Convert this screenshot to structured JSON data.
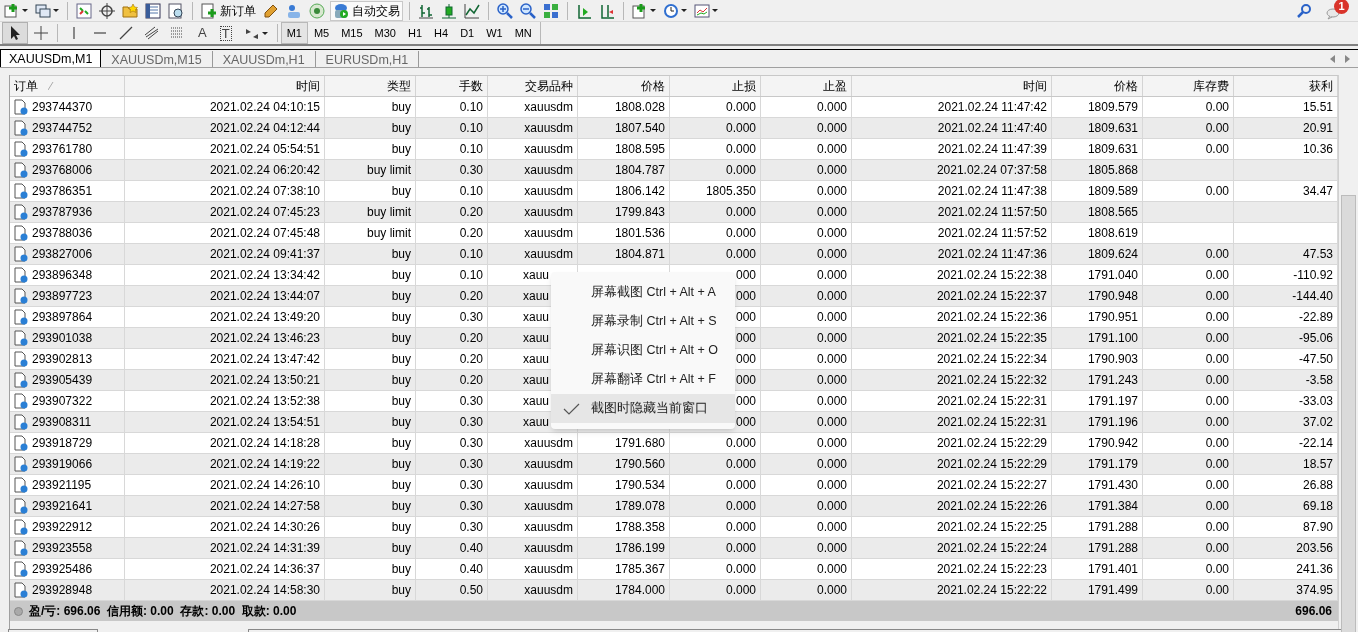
{
  "toolbar": {
    "buttons": [
      {
        "label": "新订单"
      },
      {
        "label": "自动交易"
      }
    ]
  },
  "notification": {
    "badge": "1"
  },
  "drawing_tools": [
    {
      "kind": "icon"
    },
    {
      "kind": "icon"
    },
    {
      "kind": "icon"
    },
    {
      "kind": "icon"
    },
    {
      "kind": "icon"
    },
    {
      "kind": "icon"
    },
    {
      "kind": "icon"
    },
    {
      "kind": "glyph",
      "text": "A"
    },
    {
      "kind": "glyph",
      "text": "T"
    },
    {
      "kind": "icon"
    }
  ],
  "timeframes": [
    {
      "label": "M1",
      "selected": true
    },
    {
      "label": "M5",
      "selected": false
    },
    {
      "label": "M15",
      "selected": false
    },
    {
      "label": "M30",
      "selected": false
    },
    {
      "label": "H1",
      "selected": false
    },
    {
      "label": "H4",
      "selected": false
    },
    {
      "label": "D1",
      "selected": false
    },
    {
      "label": "W1",
      "selected": false
    },
    {
      "label": "MN",
      "selected": false
    }
  ],
  "chart_tabs": [
    {
      "label": "XAUUSDm,M1",
      "selected": true
    },
    {
      "label": "XAUUSDm,M15",
      "selected": false
    },
    {
      "label": "XAUUSDm,H1",
      "selected": false
    },
    {
      "label": "EURUSDm,H1",
      "selected": false
    }
  ],
  "table": {
    "columns": [
      "订单",
      "时间",
      "类型",
      "手数",
      "交易品种",
      "价格",
      "止损",
      "止盈",
      "时间",
      "价格",
      "库存费",
      "获利"
    ],
    "rows": [
      {
        "order": "293744370",
        "open_time": "2021.02.24 04:10:15",
        "type": "buy",
        "lots": "0.10",
        "symbol": "xauusdm",
        "price": "1808.028",
        "sl": "0.000",
        "tp": "0.000",
        "close_time": "2021.02.24 11:47:42",
        "close_price": "1809.579",
        "swap": "0.00",
        "profit": "15.51"
      },
      {
        "order": "293744752",
        "open_time": "2021.02.24 04:12:44",
        "type": "buy",
        "lots": "0.10",
        "symbol": "xauusdm",
        "price": "1807.540",
        "sl": "0.000",
        "tp": "0.000",
        "close_time": "2021.02.24 11:47:40",
        "close_price": "1809.631",
        "swap": "0.00",
        "profit": "20.91"
      },
      {
        "order": "293761780",
        "open_time": "2021.02.24 05:54:51",
        "type": "buy",
        "lots": "0.10",
        "symbol": "xauusdm",
        "price": "1808.595",
        "sl": "0.000",
        "tp": "0.000",
        "close_time": "2021.02.24 11:47:39",
        "close_price": "1809.631",
        "swap": "0.00",
        "profit": "10.36"
      },
      {
        "order": "293768006",
        "open_time": "2021.02.24 06:20:42",
        "type": "buy limit",
        "lots": "0.30",
        "symbol": "xauusdm",
        "price": "1804.787",
        "sl": "0.000",
        "tp": "0.000",
        "close_time": "2021.02.24 07:37:58",
        "close_price": "1805.868"
      },
      {
        "order": "293786351",
        "open_time": "2021.02.24 07:38:10",
        "type": "buy",
        "lots": "0.10",
        "symbol": "xauusdm",
        "price": "1806.142",
        "sl": "1805.350",
        "tp": "0.000",
        "close_time": "2021.02.24 11:47:38",
        "close_price": "1809.589",
        "swap": "0.00",
        "profit": "34.47"
      },
      {
        "order": "293787936",
        "open_time": "2021.02.24 07:45:23",
        "type": "buy limit",
        "lots": "0.20",
        "symbol": "xauusdm",
        "price": "1799.843",
        "sl": "0.000",
        "tp": "0.000",
        "close_time": "2021.02.24 11:57:50",
        "close_price": "1808.565"
      },
      {
        "order": "293788036",
        "open_time": "2021.02.24 07:45:48",
        "type": "buy limit",
        "lots": "0.20",
        "symbol": "xauusdm",
        "price": "1801.536",
        "sl": "0.000",
        "tp": "0.000",
        "close_time": "2021.02.24 11:57:52",
        "close_price": "1808.619"
      },
      {
        "order": "293827006",
        "open_time": "2021.02.24 09:41:37",
        "type": "buy",
        "lots": "0.10",
        "symbol": "xauusdm",
        "price": "1804.871",
        "sl": "0.000",
        "tp": "0.000",
        "close_time": "2021.02.24 11:47:36",
        "close_price": "1809.624",
        "swap": "0.00",
        "profit": "47.53"
      },
      {
        "order": "293896348",
        "open_time": "2021.02.24 13:34:42",
        "type": "buy",
        "lots": "0.10",
        "symbol": "xauu",
        "sl": "000",
        "tp": "0.000",
        "close_time": "2021.02.24 15:22:38",
        "close_price": "1791.040",
        "swap": "0.00",
        "profit": "-110.92"
      },
      {
        "order": "293897723",
        "open_time": "2021.02.24 13:44:07",
        "type": "buy",
        "lots": "0.20",
        "symbol": "xauu",
        "sl": "000",
        "tp": "0.000",
        "close_time": "2021.02.24 15:22:37",
        "close_price": "1790.948",
        "swap": "0.00",
        "profit": "-144.40"
      },
      {
        "order": "293897864",
        "open_time": "2021.02.24 13:49:20",
        "type": "buy",
        "lots": "0.30",
        "symbol": "xauu",
        "sl": "000",
        "tp": "0.000",
        "close_time": "2021.02.24 15:22:36",
        "close_price": "1790.951",
        "swap": "0.00",
        "profit": "-22.89"
      },
      {
        "order": "293901038",
        "open_time": "2021.02.24 13:46:23",
        "type": "buy",
        "lots": "0.20",
        "symbol": "xauu",
        "sl": "000",
        "tp": "0.000",
        "close_time": "2021.02.24 15:22:35",
        "close_price": "1791.100",
        "swap": "0.00",
        "profit": "-95.06"
      },
      {
        "order": "293902813",
        "open_time": "2021.02.24 13:47:42",
        "type": "buy",
        "lots": "0.20",
        "symbol": "xauu",
        "sl": "000",
        "tp": "0.000",
        "close_time": "2021.02.24 15:22:34",
        "close_price": "1790.903",
        "swap": "0.00",
        "profit": "-47.50"
      },
      {
        "order": "293905439",
        "open_time": "2021.02.24 13:50:21",
        "type": "buy",
        "lots": "0.20",
        "symbol": "xauu",
        "sl": "000",
        "tp": "0.000",
        "close_time": "2021.02.24 15:22:32",
        "close_price": "1791.243",
        "swap": "0.00",
        "profit": "-3.58"
      },
      {
        "order": "293907322",
        "open_time": "2021.02.24 13:52:38",
        "type": "buy",
        "lots": "0.30",
        "symbol": "xauu",
        "sl": "000",
        "tp": "0.000",
        "close_time": "2021.02.24 15:22:31",
        "close_price": "1791.197",
        "swap": "0.00",
        "profit": "-33.03"
      },
      {
        "order": "293908311",
        "open_time": "2021.02.24 13:54:51",
        "type": "buy",
        "lots": "0.30",
        "symbol": "xauu",
        "sl": "000",
        "tp": "0.000",
        "close_time": "2021.02.24 15:22:31",
        "close_price": "1791.196",
        "swap": "0.00",
        "profit": "37.02"
      },
      {
        "order": "293918729",
        "open_time": "2021.02.24 14:18:28",
        "type": "buy",
        "lots": "0.30",
        "symbol": "xauusdm",
        "price": "1791.680",
        "sl": "0.000",
        "tp": "0.000",
        "close_time": "2021.02.24 15:22:29",
        "close_price": "1790.942",
        "swap": "0.00",
        "profit": "-22.14"
      },
      {
        "order": "293919066",
        "open_time": "2021.02.24 14:19:22",
        "type": "buy",
        "lots": "0.30",
        "symbol": "xauusdm",
        "price": "1790.560",
        "sl": "0.000",
        "tp": "0.000",
        "close_time": "2021.02.24 15:22:29",
        "close_price": "1791.179",
        "swap": "0.00",
        "profit": "18.57"
      },
      {
        "order": "293921195",
        "open_time": "2021.02.24 14:26:10",
        "type": "buy",
        "lots": "0.30",
        "symbol": "xauusdm",
        "price": "1790.534",
        "sl": "0.000",
        "tp": "0.000",
        "close_time": "2021.02.24 15:22:27",
        "close_price": "1791.430",
        "swap": "0.00",
        "profit": "26.88"
      },
      {
        "order": "293921641",
        "open_time": "2021.02.24 14:27:58",
        "type": "buy",
        "lots": "0.30",
        "symbol": "xauusdm",
        "price": "1789.078",
        "sl": "0.000",
        "tp": "0.000",
        "close_time": "2021.02.24 15:22:26",
        "close_price": "1791.384",
        "swap": "0.00",
        "profit": "69.18"
      },
      {
        "order": "293922912",
        "open_time": "2021.02.24 14:30:26",
        "type": "buy",
        "lots": "0.30",
        "symbol": "xauusdm",
        "price": "1788.358",
        "sl": "0.000",
        "tp": "0.000",
        "close_time": "2021.02.24 15:22:25",
        "close_price": "1791.288",
        "swap": "0.00",
        "profit": "87.90"
      },
      {
        "order": "293923558",
        "open_time": "2021.02.24 14:31:39",
        "type": "buy",
        "lots": "0.40",
        "symbol": "xauusdm",
        "price": "1786.199",
        "sl": "0.000",
        "tp": "0.000",
        "close_time": "2021.02.24 15:22:24",
        "close_price": "1791.288",
        "swap": "0.00",
        "profit": "203.56"
      },
      {
        "order": "293925486",
        "open_time": "2021.02.24 14:36:37",
        "type": "buy",
        "lots": "0.40",
        "symbol": "xauusdm",
        "price": "1785.367",
        "sl": "0.000",
        "tp": "0.000",
        "close_time": "2021.02.24 15:22:23",
        "close_price": "1791.401",
        "swap": "0.00",
        "profit": "241.36"
      },
      {
        "order": "293928948",
        "open_time": "2021.02.24 14:58:30",
        "type": "buy",
        "lots": "0.50",
        "symbol": "xauusdm",
        "price": "1784.000",
        "sl": "0.000",
        "tp": "0.000",
        "close_time": "2021.02.24 15:22:22",
        "close_price": "1791.499",
        "swap": "0.00",
        "profit": "374.95"
      }
    ]
  },
  "summary": {
    "text": "盈/亏: 696.06  信用额: 0.00  存款: 0.00  取款: 0.00",
    "total": "696.06"
  },
  "context_menu": {
    "items": [
      {
        "label": "屏幕截图 Ctrl + Alt + A",
        "checked": false,
        "highlighted": false
      },
      {
        "label": "屏幕录制 Ctrl + Alt + S",
        "checked": false,
        "highlighted": false
      },
      {
        "label": "屏幕识图 Ctrl + Alt + O",
        "checked": false,
        "highlighted": false
      },
      {
        "label": "屏幕翻译 Ctrl + Alt + F",
        "checked": false,
        "highlighted": false
      },
      {
        "label": "截图时隐藏当前窗口",
        "checked": true,
        "highlighted": true
      }
    ]
  }
}
